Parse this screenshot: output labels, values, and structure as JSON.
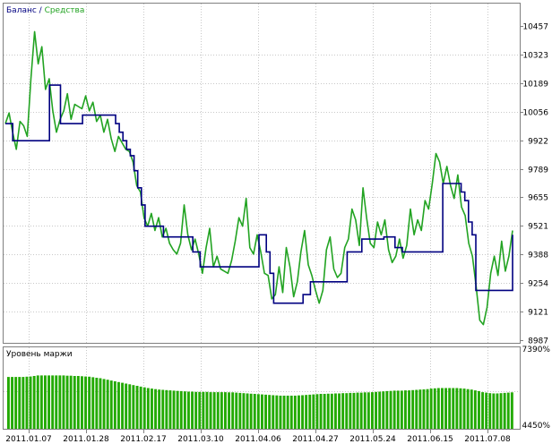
{
  "colors": {
    "balance": "#000080",
    "equity": "#22a322",
    "bars": "#22aa00",
    "grid": "#c8c8c8",
    "frame": "#808080"
  },
  "chart_data": [
    {
      "type": "line",
      "legend": {
        "balance_label": "Баланс",
        "separator": " / ",
        "equity_label": "Средства",
        "placement": "top-left"
      },
      "ylim": [
        8987,
        10457
      ],
      "y_ticks": [
        "10457",
        "10323",
        "10189",
        "10056",
        "9922",
        "9789",
        "9655",
        "9521",
        "9388",
        "9254",
        "9121",
        "8987"
      ],
      "x_ticks": [
        "2011.01.07",
        "2011.01.28",
        "2011.02.17",
        "2011.03.10",
        "2011.04.06",
        "2011.04.27",
        "2011.05.24",
        "2011.06.15",
        "2011.07.08"
      ],
      "grid": true,
      "series": [
        {
          "name": "Баланс",
          "values": [
            10000,
            10000,
            9920,
            9920,
            9920,
            9920,
            9920,
            9920,
            9920,
            9920,
            9920,
            9920,
            10180,
            10180,
            10180,
            10000,
            10000,
            10000,
            10000,
            10000,
            10000,
            10040,
            10040,
            10040,
            10040,
            10040,
            10040,
            10040,
            10040,
            10040,
            10000,
            9960,
            9920,
            9880,
            9850,
            9780,
            9700,
            9620,
            9520,
            9520,
            9520,
            9520,
            9520,
            9470,
            9470,
            9470,
            9470,
            9470,
            9470,
            9470,
            9470,
            9400,
            9400,
            9330,
            9330,
            9330,
            9330,
            9330,
            9330,
            9330,
            9330,
            9330,
            9330,
            9330,
            9330,
            9330,
            9330,
            9330,
            9330,
            9480,
            9480,
            9400,
            9300,
            9160,
            9160,
            9160,
            9160,
            9160,
            9160,
            9160,
            9160,
            9200,
            9200,
            9260,
            9260,
            9260,
            9260,
            9260,
            9260,
            9260,
            9260,
            9260,
            9260,
            9400,
            9400,
            9400,
            9400,
            9460,
            9460,
            9460,
            9460,
            9460,
            9460,
            9470,
            9470,
            9470,
            9420,
            9420,
            9400,
            9400,
            9400,
            9400,
            9400,
            9400,
            9400,
            9400,
            9400,
            9400,
            9400,
            9720,
            9720,
            9720,
            9720,
            9720,
            9680,
            9640,
            9540,
            9480,
            9220,
            9220,
            9220,
            9220,
            9220,
            9220,
            9220,
            9220,
            9220,
            9220,
            9480
          ]
        },
        {
          "name": "Средства",
          "values": [
            10000,
            10050,
            9960,
            9880,
            10010,
            9990,
            9940,
            10210,
            10430,
            10280,
            10360,
            10160,
            10210,
            10060,
            9960,
            10020,
            10060,
            10140,
            10020,
            10090,
            10080,
            10070,
            10130,
            10060,
            10100,
            10010,
            10040,
            9960,
            10020,
            9930,
            9870,
            9940,
            9910,
            9880,
            9870,
            9820,
            9710,
            9680,
            9560,
            9520,
            9580,
            9500,
            9560,
            9470,
            9510,
            9440,
            9410,
            9390,
            9440,
            9620,
            9480,
            9410,
            9460,
            9390,
            9300,
            9420,
            9510,
            9330,
            9380,
            9320,
            9310,
            9300,
            9360,
            9450,
            9560,
            9520,
            9650,
            9420,
            9390,
            9480,
            9400,
            9300,
            9290,
            9180,
            9200,
            9330,
            9210,
            9420,
            9330,
            9190,
            9260,
            9400,
            9500,
            9340,
            9290,
            9220,
            9160,
            9220,
            9410,
            9470,
            9320,
            9280,
            9300,
            9420,
            9460,
            9600,
            9550,
            9430,
            9700,
            9560,
            9440,
            9420,
            9540,
            9480,
            9550,
            9410,
            9350,
            9380,
            9460,
            9370,
            9430,
            9600,
            9480,
            9550,
            9500,
            9640,
            9600,
            9720,
            9860,
            9820,
            9720,
            9800,
            9710,
            9650,
            9760,
            9610,
            9570,
            9440,
            9380,
            9240,
            9080,
            9060,
            9140,
            9300,
            9380,
            9290,
            9450,
            9310,
            9380,
            9500
          ]
        }
      ]
    },
    {
      "type": "bar",
      "title": "Уровень маржи",
      "ylim": [
        4450,
        7390
      ],
      "y_ticks": [
        "7390%",
        "4450%"
      ],
      "grid": true,
      "series": [
        {
          "name": "Уровень маржи",
          "values": [
            6500,
            6500,
            6500,
            6500,
            6500,
            6510,
            6520,
            6540,
            6560,
            6560,
            6560,
            6560,
            6560,
            6560,
            6560,
            6560,
            6550,
            6550,
            6540,
            6540,
            6530,
            6520,
            6510,
            6490,
            6470,
            6450,
            6420,
            6390,
            6360,
            6330,
            6300,
            6270,
            6240,
            6210,
            6180,
            6150,
            6120,
            6090,
            6060,
            6040,
            6020,
            6000,
            5990,
            5980,
            5970,
            5960,
            5950,
            5940,
            5930,
            5920,
            5920,
            5910,
            5910,
            5910,
            5910,
            5900,
            5900,
            5900,
            5900,
            5900,
            5890,
            5890,
            5880,
            5870,
            5860,
            5850,
            5840,
            5830,
            5820,
            5810,
            5800,
            5790,
            5780,
            5770,
            5760,
            5760,
            5760,
            5760,
            5760,
            5770,
            5780,
            5790,
            5800,
            5810,
            5820,
            5830,
            5830,
            5840,
            5840,
            5850,
            5850,
            5860,
            5860,
            5870,
            5870,
            5880,
            5880,
            5890,
            5890,
            5900,
            5910,
            5920,
            5930,
            5940,
            5950,
            5960,
            5960,
            5960,
            5970,
            5970,
            5980,
            5990,
            6000,
            6010,
            6020,
            6040,
            6050,
            6060,
            6060,
            6060,
            6060,
            6060,
            6060,
            6050,
            6040,
            6020,
            6000,
            5970,
            5940,
            5900,
            5880,
            5860,
            5850,
            5850,
            5860,
            5870,
            5880,
            5890
          ]
        }
      ]
    }
  ]
}
